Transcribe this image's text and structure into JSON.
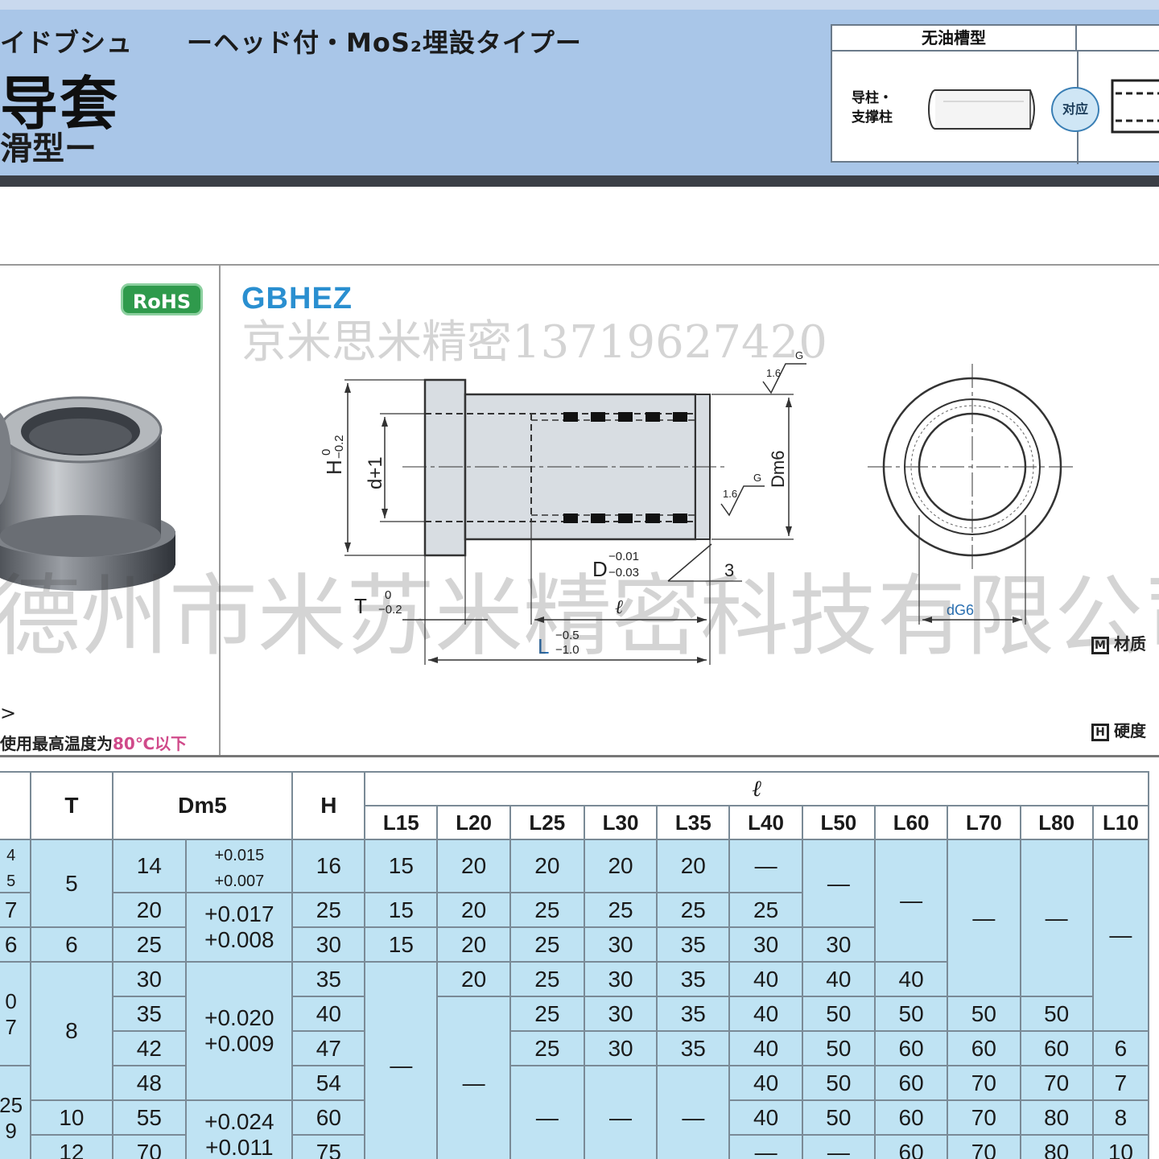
{
  "header": {
    "jp_line": "イドブシュ",
    "jp_subtype": "ーヘッド付・MoS₂埋設タイプー",
    "title": "导套",
    "subtitle": "滑型ー",
    "type_box": {
      "heading": "无油槽型",
      "label_line1": "导柱・",
      "label_line2": "支撑柱",
      "badge": "对应"
    }
  },
  "left_panel": {
    "badge": "RoHS",
    "arrow_text": ">",
    "temp_note_prefix": "使用最高温度为",
    "temp_note_value": "80℃",
    "temp_note_suffix": "以下"
  },
  "drawing": {
    "model": "GBHEZ",
    "dim_H": "H",
    "dim_H_tol_upper": "0",
    "dim_H_tol_lower": "−0.2",
    "dim_d1": "d+1",
    "dim_D": "D",
    "dim_D_tol_upper": "−0.01",
    "dim_D_tol_lower": "−0.03",
    "dim_T": "T",
    "dim_T_tol_upper": "0",
    "dim_T_tol_lower": "−0.2",
    "dim_L": "L",
    "dim_L_tol_upper": "−0.5",
    "dim_L_tol_lower": "−1.0",
    "dim_l": "ℓ",
    "dim_Dm6": "Dm6",
    "dim_3": "3",
    "dim_dG6": "dG6",
    "rough1": "1.6",
    "rough_sym": "G",
    "rough2": "1.6",
    "note_material": "材质",
    "note_hardness": "硬度",
    "note_material_icon": "M",
    "note_hardness_icon": "H"
  },
  "watermarks": {
    "phone": "京米思米精密13719627420",
    "company": "德州市米苏米精密科技有限公司"
  },
  "table": {
    "headers": {
      "T": "T",
      "Dm5": "Dm5",
      "H": "H",
      "ell": "ℓ",
      "L": [
        "L15",
        "L20",
        "L25",
        "L30",
        "L35",
        "L40",
        "L50",
        "L60",
        "L70",
        "L80",
        "L10"
      ]
    },
    "frag": [
      "4",
      "5",
      "7",
      "6",
      "0",
      "7",
      "25",
      "9"
    ],
    "T": [
      "5",
      "6",
      "8",
      "10",
      "12"
    ],
    "Dm5": [
      "14",
      "20",
      "25",
      "30",
      "35",
      "42",
      "48",
      "55",
      "70"
    ],
    "tol": [
      {
        "u": "+0.015",
        "l": "+0.007"
      },
      {
        "u": "+0.017",
        "l": "+0.008"
      },
      {
        "u": "+0.020",
        "l": "+0.009"
      },
      {
        "u": "+0.024",
        "l": "+0.011"
      }
    ],
    "H": [
      "16",
      "25",
      "30",
      "35",
      "40",
      "47",
      "54",
      "60",
      "75"
    ],
    "dash": "—",
    "cells": {
      "r1": [
        "15",
        "20",
        "20",
        "20",
        "20"
      ],
      "r2": [
        "15",
        "20",
        "25",
        "25",
        "25",
        "25"
      ],
      "r3": [
        "15",
        "20",
        "25",
        "30",
        "35",
        "30",
        "30"
      ],
      "r4": [
        "20",
        "25",
        "30",
        "35",
        "40",
        "40",
        "40"
      ],
      "r5": [
        "25",
        "30",
        "35",
        "40",
        "50",
        "50",
        "50",
        "50"
      ],
      "r6": [
        "25",
        "30",
        "35",
        "40",
        "50",
        "60",
        "60",
        "60",
        "6"
      ],
      "r7": [
        "40",
        "50",
        "60",
        "70",
        "70",
        "7"
      ],
      "r8": [
        "40",
        "50",
        "60",
        "70",
        "80",
        "8"
      ],
      "r9": [
        "60",
        "70",
        "80",
        "10"
      ]
    }
  },
  "colors": {
    "header_bg": "#a9c6e8",
    "table_fill": "#bfe3f3",
    "model_blue": "#2a8fd0",
    "rohs_green": "#2f9a4c"
  }
}
